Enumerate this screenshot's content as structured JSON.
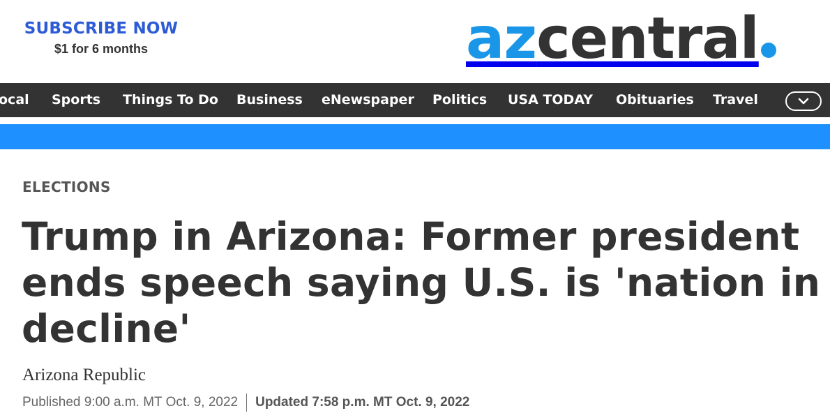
{
  "header": {
    "subscribe_title": "SUBSCRIBE NOW",
    "subscribe_offer": "$1 for 6 months",
    "logo_prefix": "az",
    "logo_suffix": "central",
    "accent_color": "#1a96e8",
    "dark_color": "#333333"
  },
  "nav": {
    "items": [
      "ocal",
      "Sports",
      "Things To Do",
      "Business",
      "eNewspaper",
      "Politics",
      "USA TODAY",
      "Obituaries",
      "Travel"
    ],
    "more_icon": "chevron-down-icon",
    "background": "#333333"
  },
  "band_color": "#1e90ff",
  "article": {
    "category": "ELECTIONS",
    "headline": "Trump in Arizona: Former president ends speech saying U.S. is 'nation in decline'",
    "byline": "Arizona Republic",
    "published": "Published 9:00 a.m. MT Oct. 9, 2022",
    "updated": "Updated 7:58 p.m. MT Oct. 9, 2022"
  }
}
